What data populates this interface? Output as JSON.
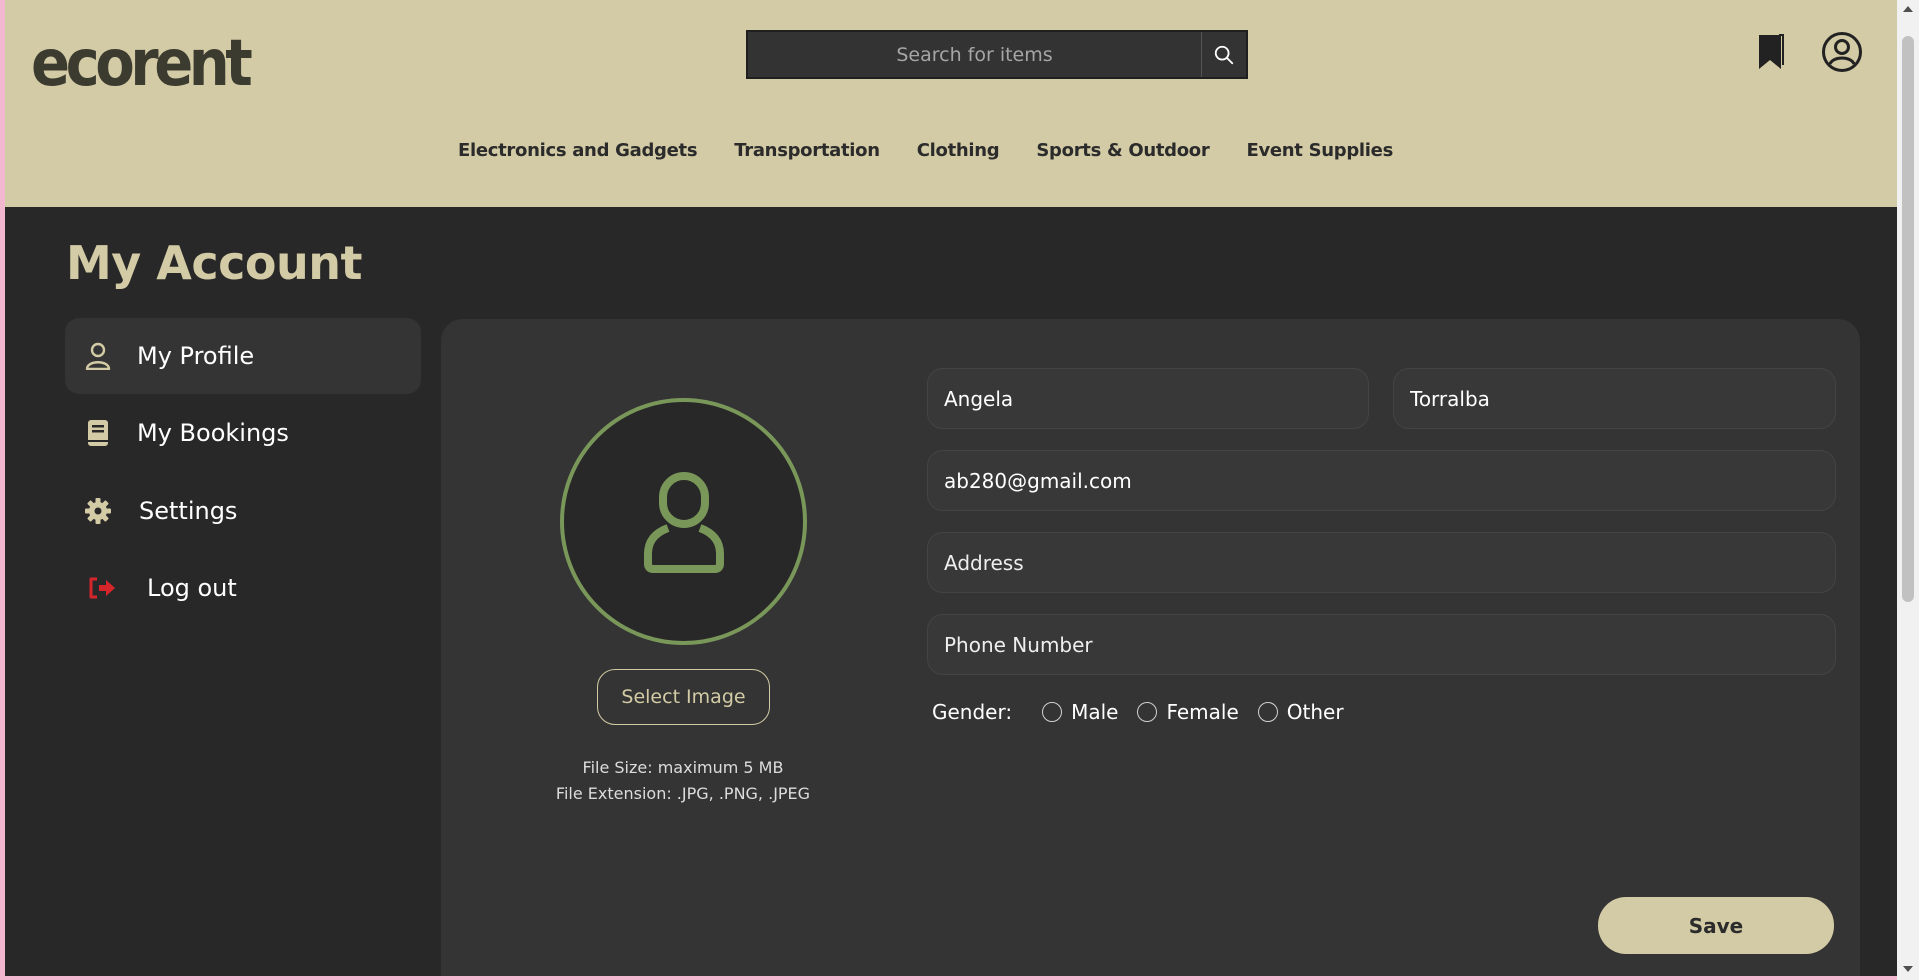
{
  "header": {
    "logo_text": "ecorent",
    "search": {
      "placeholder": "Search for items"
    },
    "nav": [
      "Electronics and Gadgets",
      "Transportation",
      "Clothing",
      "Sports & Outdoor",
      "Event Supplies"
    ]
  },
  "page": {
    "title": "My Account"
  },
  "sidebar": {
    "items": [
      {
        "label": "My Profile",
        "icon": "user-icon",
        "active": true
      },
      {
        "label": "My Bookings",
        "icon": "book-icon",
        "active": false
      },
      {
        "label": "Settings",
        "icon": "gear-icon",
        "active": false
      },
      {
        "label": "Log out",
        "icon": "logout-icon",
        "active": false
      }
    ]
  },
  "profile": {
    "select_image_label": "Select Image",
    "file_size_note": "File Size: maximum 5 MB",
    "file_ext_note": "File Extension: .JPG, .PNG, .JPEG",
    "first_name": "Angela",
    "last_name": "Torralba",
    "email": "ab280@gmail.com",
    "address_placeholder": "Address",
    "phone_placeholder": "Phone Number",
    "gender_label": "Gender:",
    "gender_options": [
      "Male",
      "Female",
      "Other"
    ],
    "save_label": "Save"
  },
  "colors": {
    "header_bg": "#d3cba5",
    "page_bg": "#282828",
    "panel_bg": "#343434",
    "accent_green": "#7a975a",
    "logout_red": "#d6262c"
  }
}
